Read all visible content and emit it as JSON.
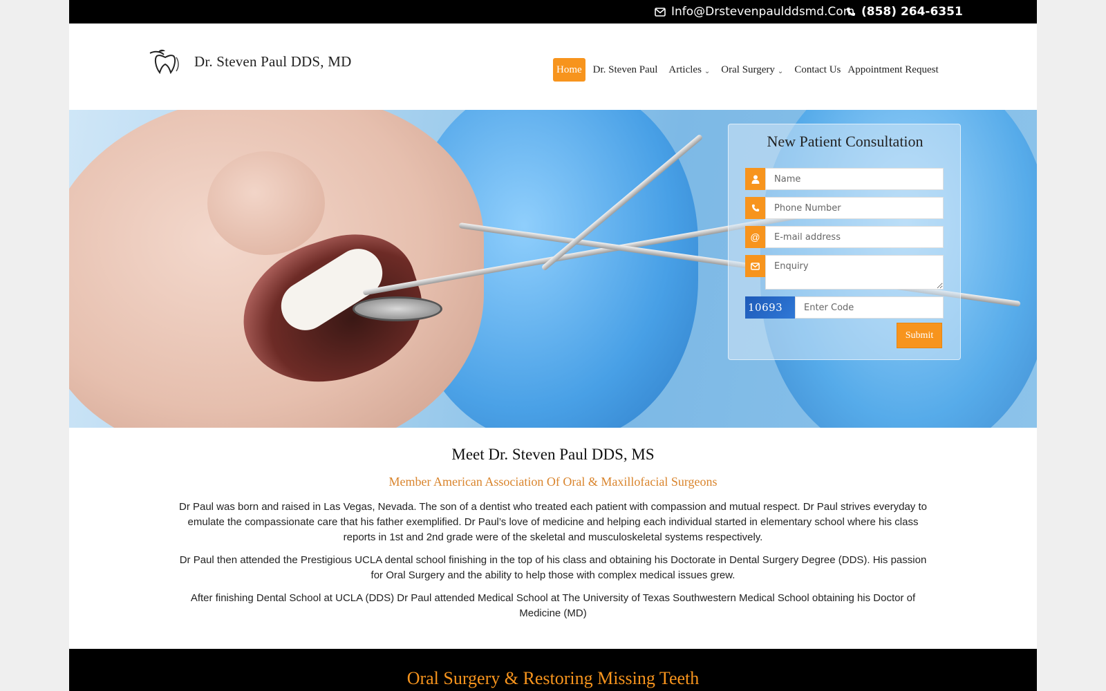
{
  "topbar": {
    "email": "Info@Drstevenpaulddsmd.Com",
    "phone": "(858) 264-6351"
  },
  "logo": {
    "text": "Dr. Steven Paul DDS, MD"
  },
  "nav": {
    "items": [
      {
        "label": "Home",
        "active": true
      },
      {
        "label": "Dr. Steven Paul"
      },
      {
        "label": "Articles",
        "dropdown": true
      },
      {
        "label": "Oral Surgery",
        "dropdown": true
      },
      {
        "label": "Contact Us"
      },
      {
        "label": "Appointment Request"
      }
    ]
  },
  "form": {
    "title": "New Patient Consultation",
    "name_placeholder": "Name",
    "phone_placeholder": "Phone Number",
    "email_placeholder": "E-mail address",
    "enquiry_placeholder": "Enquiry",
    "captcha_code": "10693",
    "code_placeholder": "Enter Code",
    "submit_label": "Submit"
  },
  "about": {
    "title": "Meet Dr. Steven Paul DDS, MS",
    "subtitle": "Member American Association Of Oral & Maxillofacial Surgeons",
    "paragraphs": [
      "Dr Paul was born and raised in Las Vegas, Nevada. The son of a dentist who treated each patient with compassion and mutual respect. Dr Paul strives everyday to emulate the compassionate care that his father exemplified. Dr Paul’s love of medicine and helping each individual started in elementary school where his class reports in 1st and 2nd grade were of the skeletal and musculoskeletal systems respectively.",
      "Dr Paul then attended the Prestigious UCLA dental school finishing in the top of his class and obtaining his Doctorate in Dental Surgery Degree (DDS). His passion for Oral Surgery and the ability to help those with complex medical issues grew.",
      "After finishing Dental School at UCLA (DDS) Dr Paul attended Medical School at The University of Texas Southwestern Medical School obtaining his Doctor of Medicine (MD)"
    ]
  },
  "section2": {
    "title": "Oral Surgery & Restoring Missing Teeth"
  },
  "colors": {
    "accent": "#f7941d",
    "subtitle": "#d9842c",
    "topbar": "#000000"
  }
}
